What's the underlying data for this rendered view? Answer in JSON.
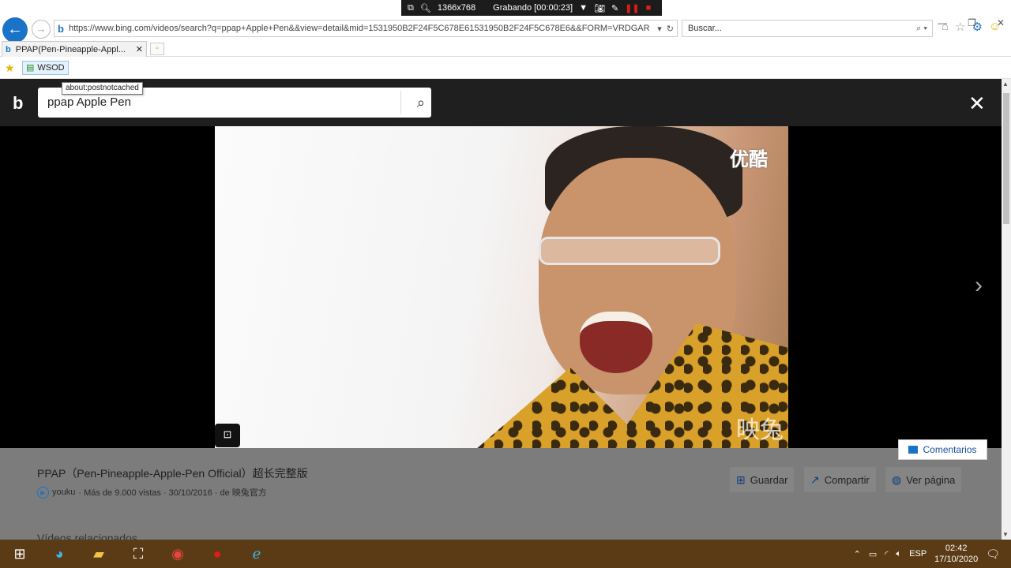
{
  "recorder": {
    "resolution": "1366x768",
    "status": "Grabando [00:00:23]"
  },
  "browser": {
    "url": "https://www.bing.com/videos/search?q=ppap+Apple+Pen&&view=detail&mid=1531950B2F24F5C678E61531950B2F24F5C678E6&&FORM=VRDGAR",
    "search_placeholder": "Buscar...",
    "tab_title": "PPAP(Pen-Pineapple-Appl...",
    "favorite_label": "WSOD",
    "tooltip": "about:postnotcached"
  },
  "bing": {
    "query": "ppap Apple Pen",
    "video": {
      "watermark_top": "优酷",
      "watermark_bottom": "映兔",
      "title": "PPAP（Pen-Pineapple-Apple-Pen Official）超长完整版",
      "source": "youku",
      "meta": "· Más de 9.000 vistas · 30/10/2016 · de 映兔官方"
    },
    "actions": {
      "save": "Guardar",
      "share": "Compartir",
      "view_page": "Ver página"
    },
    "related_heading": "Vídeos relacionados",
    "feedback": "Comentarios"
  },
  "taskbar": {
    "language": "ESP",
    "time": "02:42",
    "date": "17/10/2020"
  },
  "colors": {
    "accent": "#1a73c7",
    "overlay_bg": "#1f1f1f",
    "info_panel": "#7c7c7c",
    "taskbar": "#5b3b16"
  }
}
